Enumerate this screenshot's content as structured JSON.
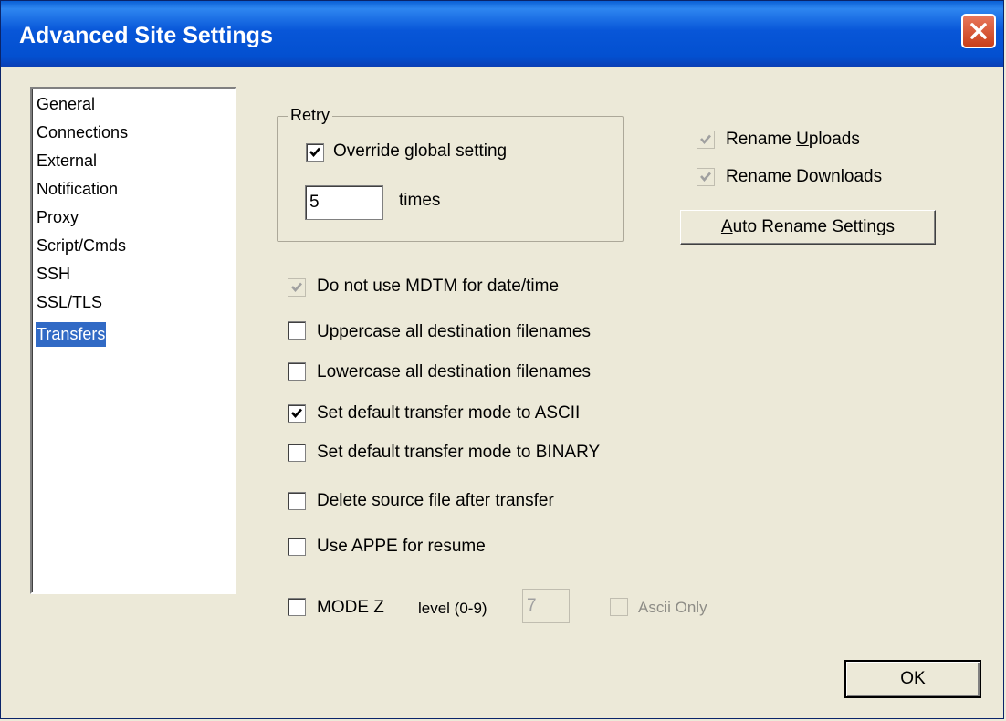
{
  "window": {
    "title": "Advanced Site Settings"
  },
  "nav": {
    "items": [
      {
        "label": "General"
      },
      {
        "label": "Connections"
      },
      {
        "label": "External"
      },
      {
        "label": "Notification"
      },
      {
        "label": "Proxy"
      },
      {
        "label": "Script/Cmds"
      },
      {
        "label": "SSH"
      },
      {
        "label": "SSL/TLS"
      },
      {
        "label": "Transfers",
        "selected": true
      }
    ]
  },
  "retry": {
    "legend": "Retry",
    "override_label": "Override global setting",
    "override_checked": true,
    "times_value": "5",
    "times_label": "times"
  },
  "rename": {
    "uploads_label": "Rename Uploads",
    "uploads_accel": "U",
    "uploads_checked": true,
    "uploads_disabled": true,
    "downloads_label": "Rename Downloads",
    "downloads_accel": "D",
    "downloads_checked": true,
    "downloads_disabled": true,
    "auto_button": "Auto Rename Settings",
    "auto_accel": "A"
  },
  "options": [
    {
      "label": "Do not use MDTM for date/time",
      "checked": true,
      "disabled": true
    },
    {
      "label": "Uppercase all destination filenames",
      "checked": false
    },
    {
      "label": "Lowercase all destination filenames",
      "checked": false
    },
    {
      "label": "Set default transfer mode to ASCII",
      "checked": true
    },
    {
      "label": "Set default transfer mode to BINARY",
      "checked": false
    },
    {
      "label": "Delete source file after transfer",
      "checked": false
    },
    {
      "label": "Use APPE for resume",
      "checked": false
    }
  ],
  "modez": {
    "label": "MODE Z",
    "checked": false,
    "level_label": "level (0-9)",
    "level_value": "7",
    "ascii_only_label": "Ascii Only",
    "ascii_only_checked": false
  },
  "footer": {
    "ok_label": "OK"
  },
  "colors": {
    "title_bar": "#0856d8",
    "selection": "#316ac5",
    "face": "#ece9d8",
    "close": "#c93f19"
  }
}
